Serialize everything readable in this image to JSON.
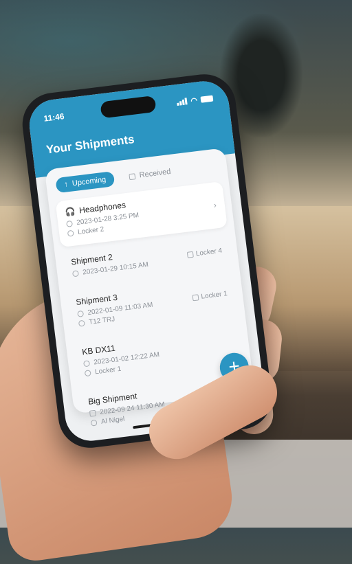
{
  "status": {
    "time": "11:46"
  },
  "header": {
    "title": "Your Shipments"
  },
  "tabs": [
    {
      "label": "Upcoming",
      "icon": "arrow-up-icon"
    },
    {
      "label": "Received",
      "icon": "box-icon"
    }
  ],
  "shipments": [
    {
      "name": "Headphones",
      "date": "2023-01-28 3:25 PM",
      "locker": "Locker 2"
    },
    {
      "name": "Shipment 2",
      "date": "2023-01-29 10:15 AM",
      "locker": "Locker 4"
    },
    {
      "name": "Shipment 3",
      "date": "2022-01-09 11:03 AM",
      "code": "T12 TRJ",
      "locker": "Locker 1"
    },
    {
      "name": "KB DX11",
      "date": "2023-01-02 12:22 AM",
      "locker": "Locker 1"
    },
    {
      "name": "Big Shipment",
      "date": "2022-09 24 11:30 AM",
      "recipient": "Al Nigel"
    }
  ],
  "colors": {
    "accent": "#2b95c2"
  }
}
